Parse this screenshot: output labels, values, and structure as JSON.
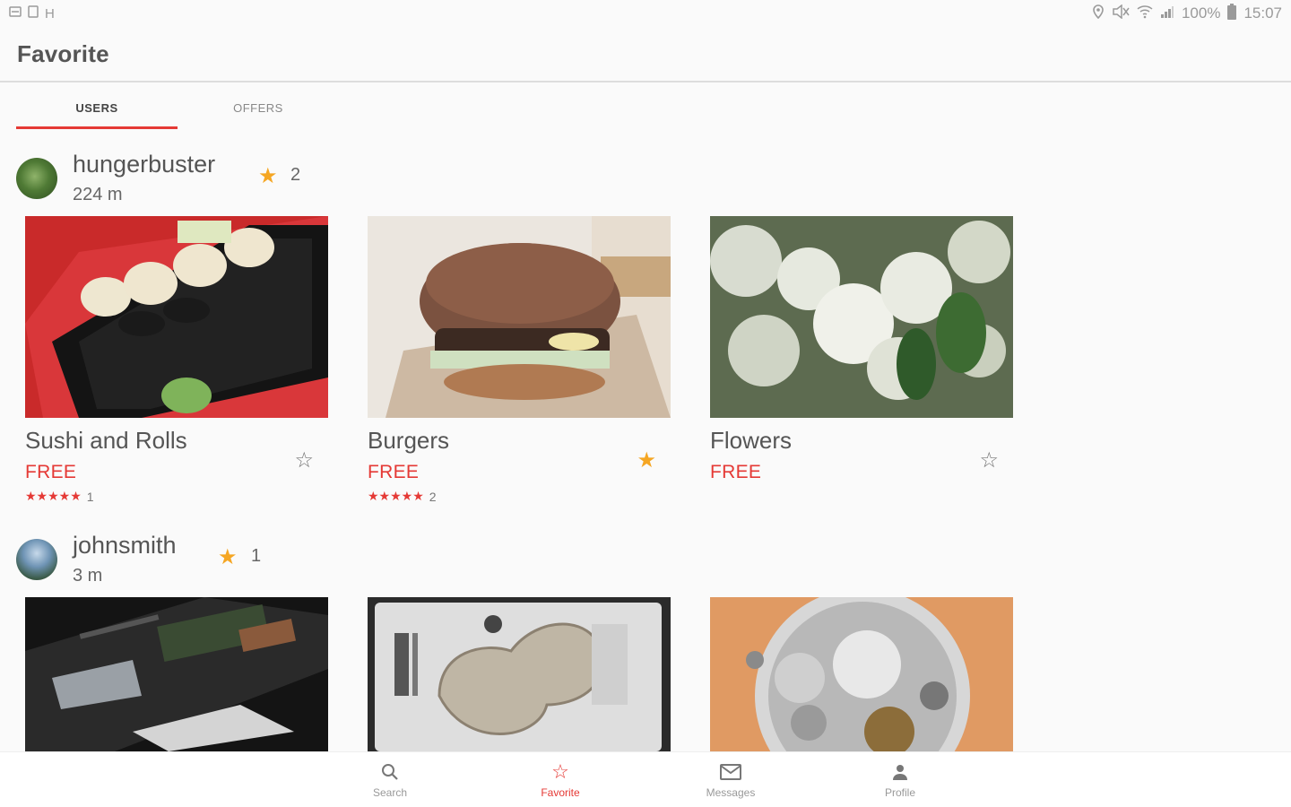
{
  "status_bar": {
    "left_icons": [
      "notification-icon",
      "tablet-icon",
      "h-icon"
    ],
    "h_label": "H",
    "battery": "100%",
    "time": "15:07"
  },
  "app_bar": {
    "title": "Favorite"
  },
  "tabs": [
    {
      "label": "USERS",
      "active": true
    },
    {
      "label": "OFFERS",
      "active": false
    }
  ],
  "users": [
    {
      "username": "hungerbuster",
      "distance": "224 m",
      "favorite_count": "2",
      "offers": [
        {
          "title": "Sushi and Rolls",
          "price": "FREE",
          "stars": "★★★★★",
          "rating_count": "1",
          "favorited": false,
          "image": "sushi"
        },
        {
          "title": "Burgers",
          "price": "FREE",
          "stars": "★★★★★",
          "rating_count": "2",
          "favorited": true,
          "image": "burger"
        },
        {
          "title": "Flowers",
          "price": "FREE",
          "stars": "",
          "rating_count": "",
          "favorited": false,
          "image": "flowers"
        }
      ]
    },
    {
      "username": "johnsmith",
      "distance": "3 m",
      "favorite_count": "1",
      "offers": [
        {
          "image": "laptop-internals"
        },
        {
          "image": "hard-drive"
        },
        {
          "image": "watch-movement"
        }
      ]
    }
  ],
  "bottom_nav": [
    {
      "label": "Search",
      "icon": "search-icon",
      "active": false
    },
    {
      "label": "Favorite",
      "icon": "star-icon",
      "active": true
    },
    {
      "label": "Messages",
      "icon": "mail-icon",
      "active": false
    },
    {
      "label": "Profile",
      "icon": "person-icon",
      "active": false
    }
  ],
  "colors": {
    "accent": "#e53935",
    "star": "#f5a623",
    "background": "#fafafa"
  }
}
